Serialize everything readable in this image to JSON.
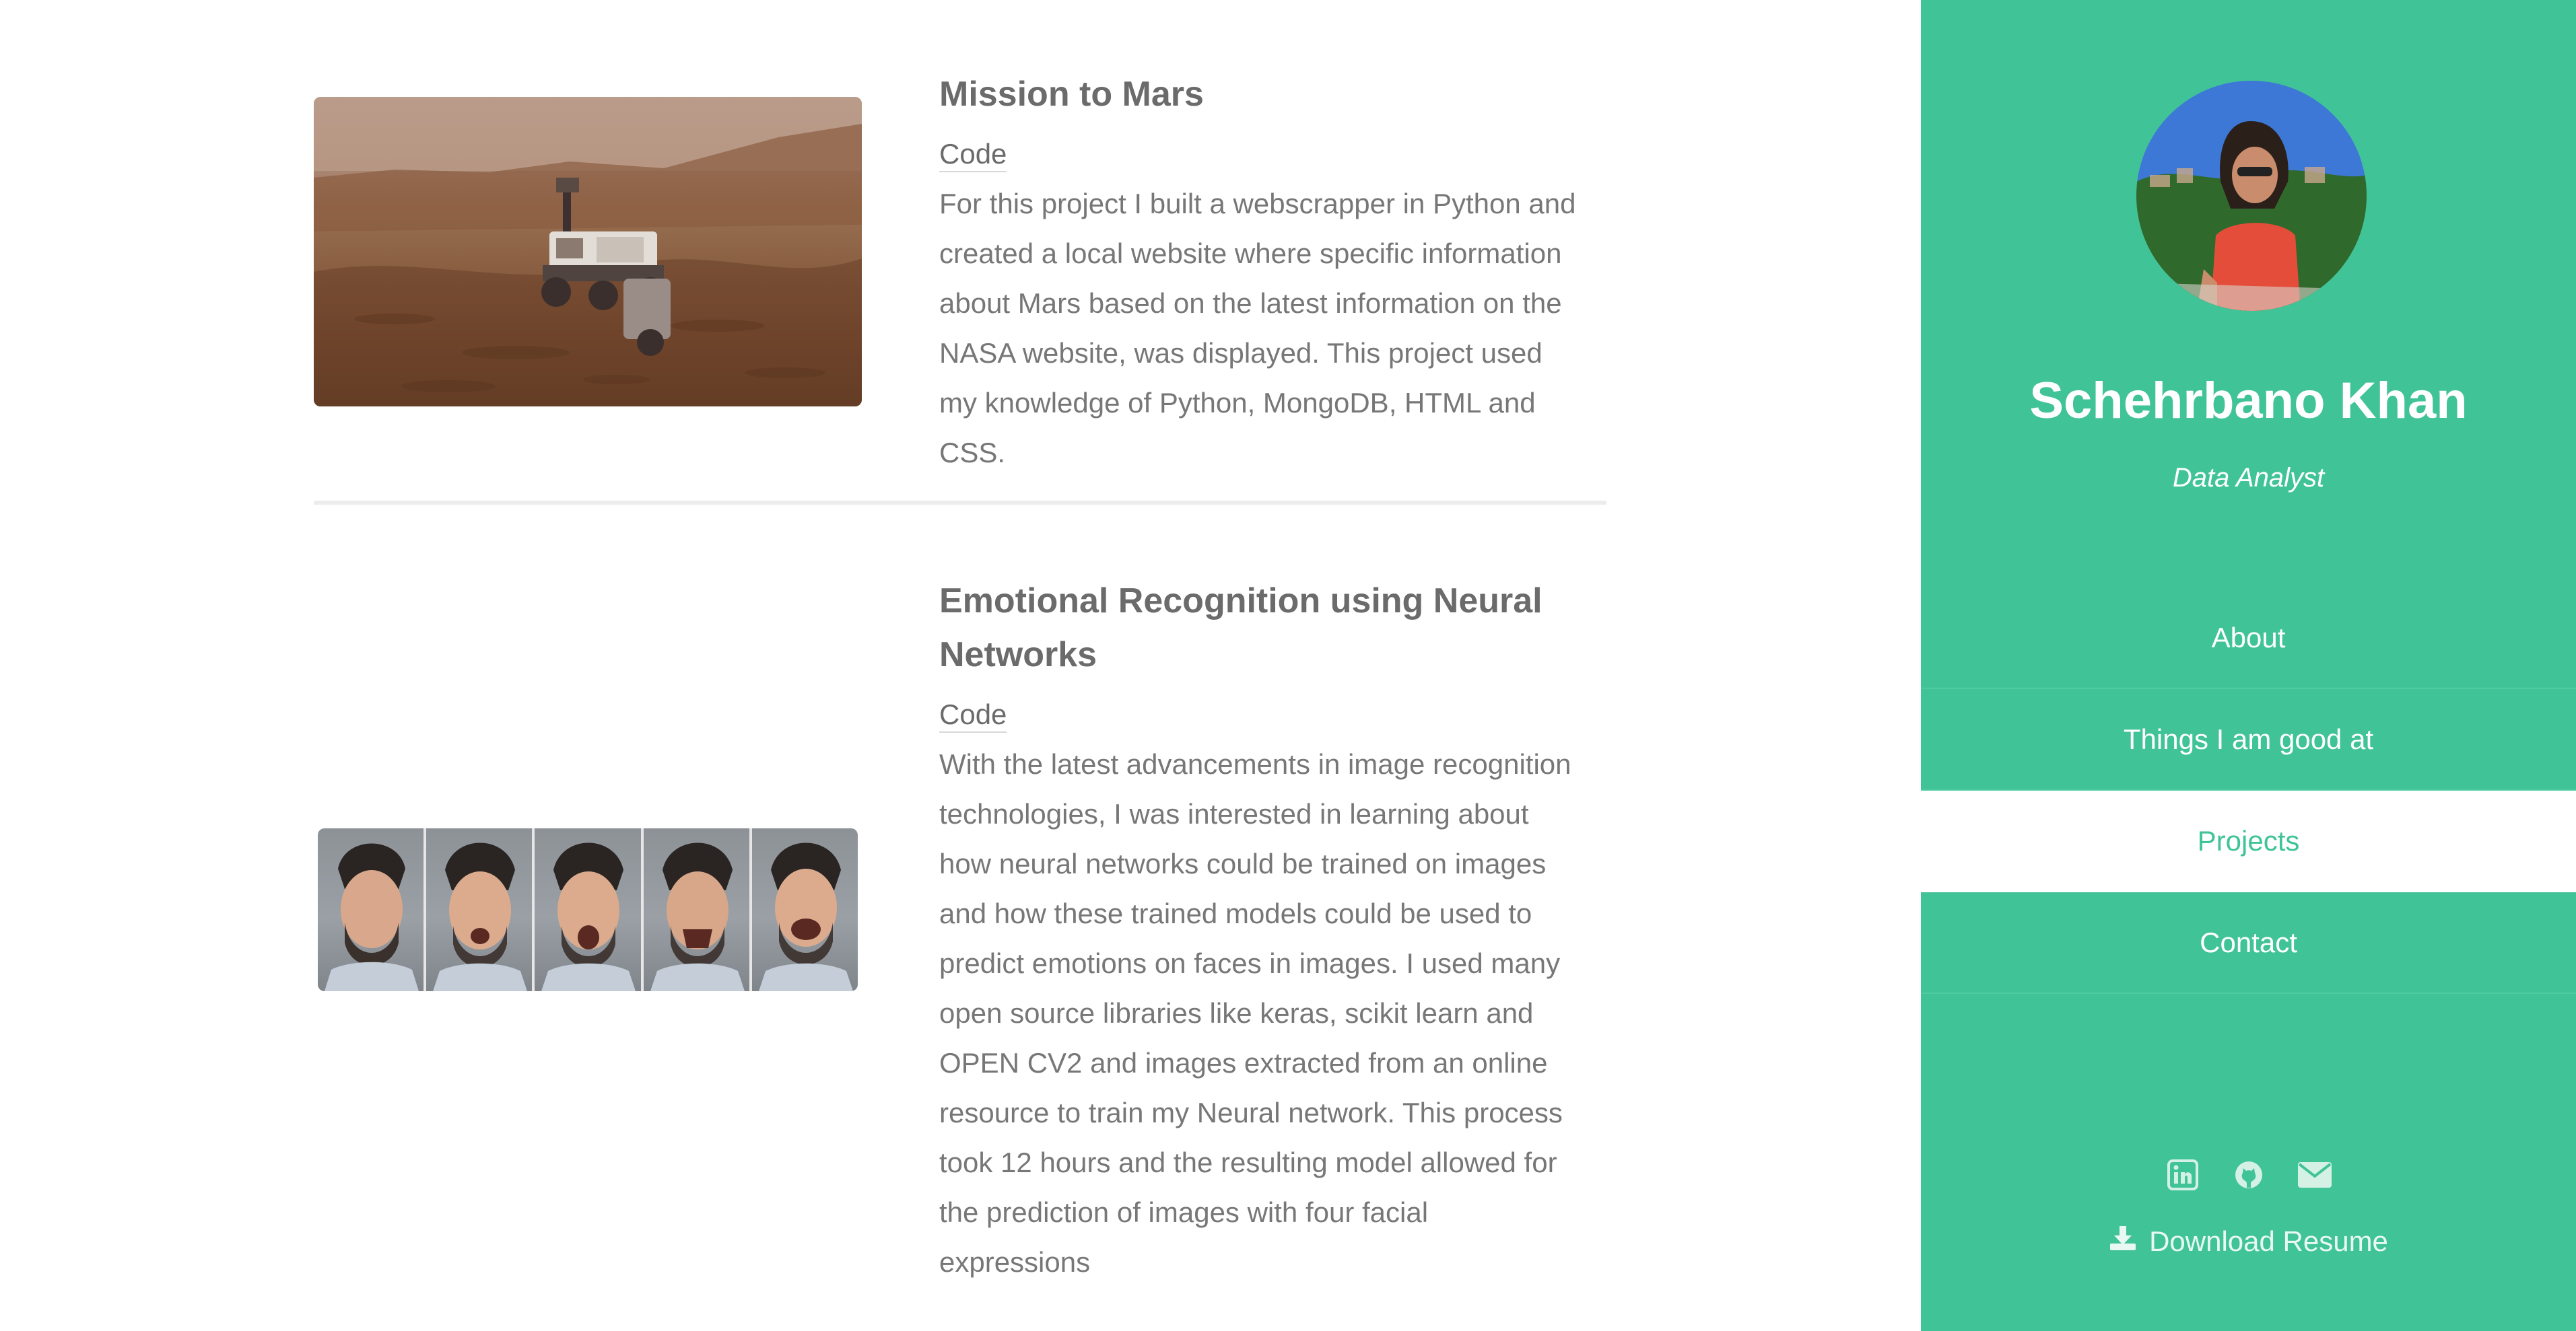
{
  "projects": [
    {
      "title": "Mission to Mars",
      "code_label": "Code",
      "description": "For this project I built a webscrapper in Python and created a local website where specific information about Mars based on the latest information on the NASA website, was displayed. This project used my knowledge of Python, MongoDB, HTML and CSS."
    },
    {
      "title": "Emotional Recognition using Neural Networks",
      "code_label": "Code",
      "description": "With the latest advancements in image recognition technologies, I was interested in learning about how neural networks could be trained on images and how these trained models could be used to predict emotions on faces in images. I used many open source libraries like keras, scikit learn and OPEN CV2 and images extracted from an online resource to train my Neural network. This process took 12 hours and the resulting model allowed for the prediction of images with four facial expressions"
    }
  ],
  "sidebar": {
    "name": "Schehrbano Khan",
    "role": "Data Analyst",
    "nav": [
      "About",
      "Things I am good at",
      "Projects",
      "Contact"
    ],
    "active_nav": "Projects",
    "socials": [
      "linkedin-icon",
      "github-icon",
      "envelope-icon"
    ],
    "download_label": "Download Resume"
  },
  "colors": {
    "accent": "#41c398",
    "text": "#6b6b6b",
    "background": "#ffffff"
  }
}
